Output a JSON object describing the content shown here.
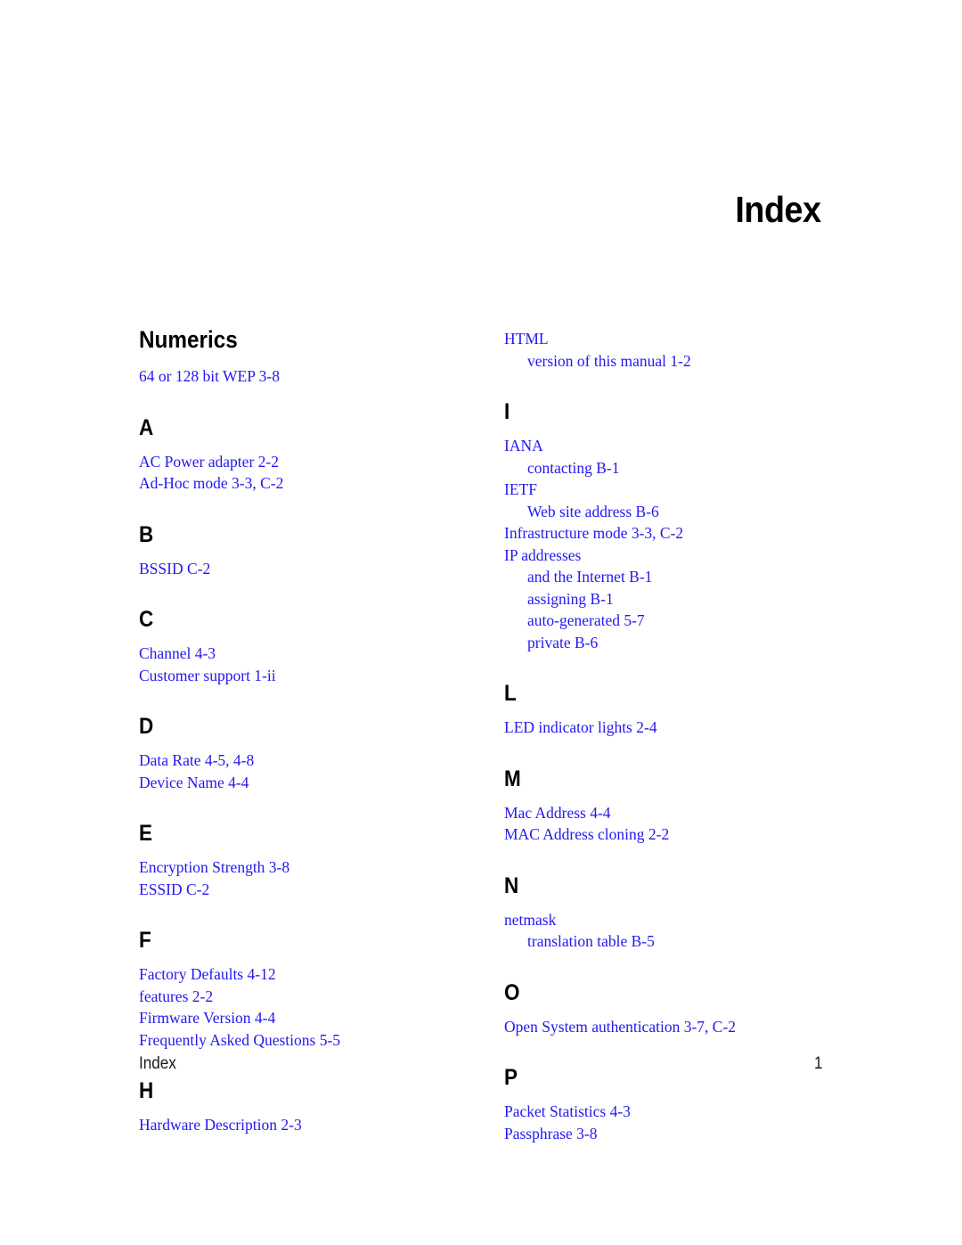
{
  "document": {
    "chapter_title": "Index",
    "footer_label": "Index",
    "footer_page": "1",
    "entry_color": "#2318f0",
    "heading_color": "#000000"
  },
  "columns": {
    "left": [
      {
        "heading": "Numerics",
        "heading_kind": "word",
        "entries": [
          {
            "text": "64 or 128 bit WEP  3-8",
            "level": 0
          }
        ]
      },
      {
        "heading": "A",
        "heading_kind": "letter",
        "entries": [
          {
            "text": "AC Power adapter  2-2",
            "level": 0
          },
          {
            "text": "Ad-Hoc mode  3-3, C-2",
            "level": 0
          }
        ]
      },
      {
        "heading": "B",
        "heading_kind": "letter",
        "entries": [
          {
            "text": "BSSID  C-2",
            "level": 0
          }
        ]
      },
      {
        "heading": "C",
        "heading_kind": "letter",
        "entries": [
          {
            "text": "Channel  4-3",
            "level": 0
          },
          {
            "text": "Customer support  1-ii",
            "level": 0
          }
        ]
      },
      {
        "heading": "D",
        "heading_kind": "letter",
        "entries": [
          {
            "text": "Data Rate  4-5, 4-8",
            "level": 0
          },
          {
            "text": "Device Name  4-4",
            "level": 0
          }
        ]
      },
      {
        "heading": "E",
        "heading_kind": "letter",
        "entries": [
          {
            "text": "Encryption Strength  3-8",
            "level": 0
          },
          {
            "text": "ESSID  C-2",
            "level": 0
          }
        ]
      },
      {
        "heading": "F",
        "heading_kind": "letter",
        "entries": [
          {
            "text": "Factory Defaults  4-12",
            "level": 0
          },
          {
            "text": "features  2-2",
            "level": 0
          },
          {
            "text": "Firmware Version  4-4",
            "level": 0
          },
          {
            "text": "Frequently Asked Questions  5-5",
            "level": 0
          }
        ]
      },
      {
        "heading": "H",
        "heading_kind": "letter",
        "entries": [
          {
            "text": "Hardware Description  2-3",
            "level": 0
          }
        ]
      }
    ],
    "right": [
      {
        "heading": "",
        "heading_kind": "none",
        "entries": [
          {
            "text": "HTML",
            "level": 0
          },
          {
            "text": "version of this manual  1-2",
            "level": 1
          }
        ]
      },
      {
        "heading": "I",
        "heading_kind": "letter",
        "entries": [
          {
            "text": "IANA",
            "level": 0
          },
          {
            "text": "contacting  B-1",
            "level": 1
          },
          {
            "text": "IETF",
            "level": 0
          },
          {
            "text": "Web site address  B-6",
            "level": 1
          },
          {
            "text": "Infrastructure mode  3-3, C-2",
            "level": 0
          },
          {
            "text": "IP addresses",
            "level": 0
          },
          {
            "text": "and the Internet  B-1",
            "level": 1
          },
          {
            "text": "assigning  B-1",
            "level": 1
          },
          {
            "text": "auto-generated  5-7",
            "level": 1
          },
          {
            "text": "private  B-6",
            "level": 1
          }
        ]
      },
      {
        "heading": "L",
        "heading_kind": "letter",
        "entries": [
          {
            "text": "LED indicator lights  2-4",
            "level": 0
          }
        ]
      },
      {
        "heading": "M",
        "heading_kind": "letter",
        "entries": [
          {
            "text": "Mac Address  4-4",
            "level": 0
          },
          {
            "text": "MAC Address cloning  2-2",
            "level": 0
          }
        ]
      },
      {
        "heading": "N",
        "heading_kind": "letter",
        "entries": [
          {
            "text": "netmask",
            "level": 0
          },
          {
            "text": "translation table  B-5",
            "level": 1
          }
        ]
      },
      {
        "heading": "O",
        "heading_kind": "letter",
        "entries": [
          {
            "text": "Open System authentication  3-7, C-2",
            "level": 0
          }
        ]
      },
      {
        "heading": "P",
        "heading_kind": "letter",
        "entries": [
          {
            "text": "Packet Statistics  4-3",
            "level": 0
          },
          {
            "text": "Passphrase  3-8",
            "level": 0
          }
        ]
      }
    ]
  }
}
